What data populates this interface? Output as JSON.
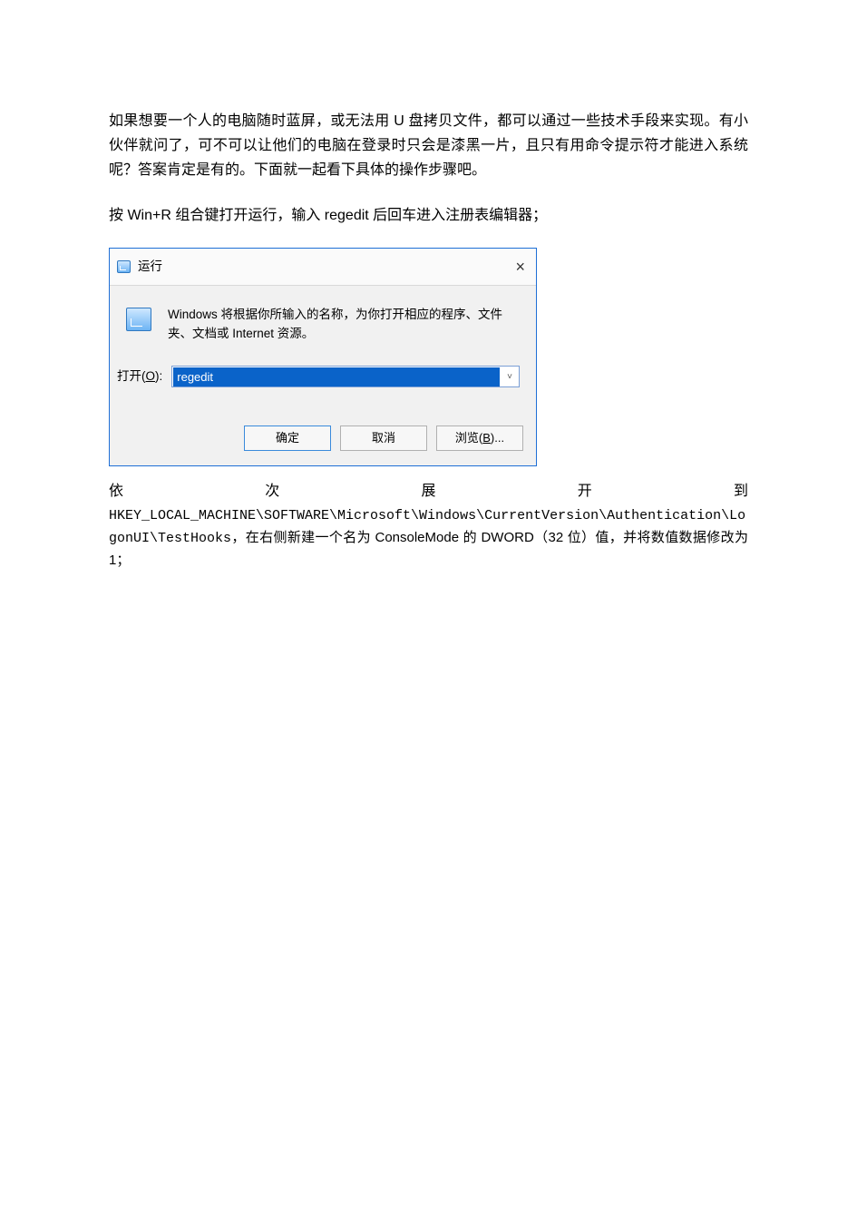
{
  "doc": {
    "para1": "如果想要一个人的电脑随时蓝屏，或无法用 U 盘拷贝文件，都可以通过一些技术手段来实现。有小伙伴就问了，可不可以让他们的电脑在登录时只会是漆黑一片，且只有用命令提示符才能进入系统呢？答案肯定是有的。下面就一起看下具体的操作步骤吧。",
    "para2": "按 Win+R 组合键打开运行，输入 regedit 后回车进入注册表编辑器；",
    "justify": {
      "c1": "依",
      "c2": "次",
      "c3": "展",
      "c4": "开",
      "c5": "到"
    },
    "reg_path": "HKEY_LOCAL_MACHINE\\SOFTWARE\\Microsoft\\Windows\\CurrentVersion\\Authentication\\LogonUI\\TestHooks",
    "para3_tail": "，在右侧新建一个名为 ConsoleMode 的 DWORD（32 位）值，并将数值数据修改为 1；"
  },
  "run_dialog": {
    "title": "运行",
    "description": "Windows 将根据你所输入的名称，为你打开相应的程序、文件夹、文档或 Internet 资源。",
    "open_prefix": "打开(",
    "open_key": "O",
    "open_suffix": "):",
    "value": "regedit",
    "ok": "确定",
    "cancel": "取消",
    "browse_prefix": "浏览(",
    "browse_key": "B",
    "browse_suffix": ")...",
    "close": "×",
    "caret": "˅"
  }
}
